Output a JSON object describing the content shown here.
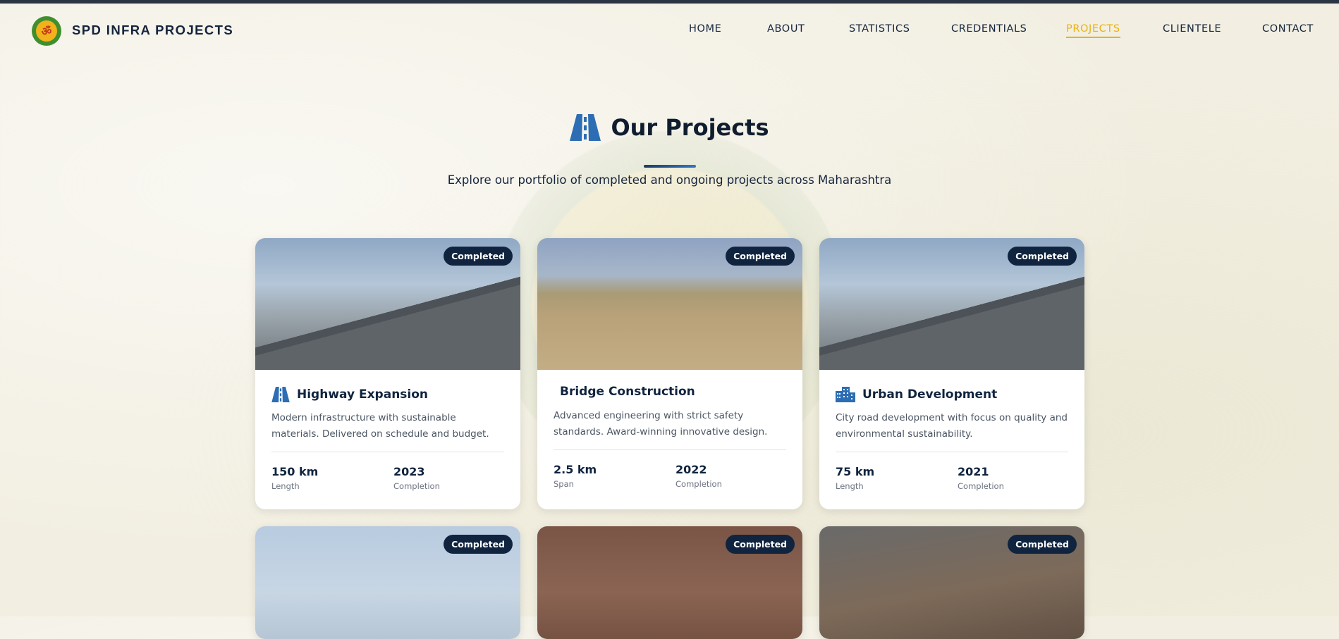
{
  "brand": {
    "name": "SPD INFRA PROJECTS",
    "logo_icon": "company-logo"
  },
  "nav": {
    "items": [
      {
        "label": "HOME"
      },
      {
        "label": "ABOUT"
      },
      {
        "label": "STATISTICS"
      },
      {
        "label": "CREDENTIALS"
      },
      {
        "label": "PROJECTS",
        "active": true
      },
      {
        "label": "CLIENTELE"
      },
      {
        "label": "CONTACT"
      }
    ]
  },
  "hero": {
    "icon": "road-icon",
    "title": "Our Projects",
    "subtitle": "Explore our portfolio of completed and ongoing projects across Maharashtra"
  },
  "projects": [
    {
      "badge": "Completed",
      "icon": "road-icon",
      "title": "Highway Expansion",
      "desc": "Modern infrastructure with sustainable materials. Delivered on schedule and budget.",
      "stat1_value": "150 km",
      "stat1_label": "Length",
      "stat2_value": "2023",
      "stat2_label": "Completion"
    },
    {
      "badge": "Completed",
      "icon": "",
      "title": "Bridge Construction",
      "desc": "Advanced engineering with strict safety standards. Award-winning innovative design.",
      "stat1_value": "2.5 km",
      "stat1_label": "Span",
      "stat2_value": "2022",
      "stat2_label": "Completion"
    },
    {
      "badge": "Completed",
      "icon": "city-icon",
      "title": "Urban Development",
      "desc": "City road development with focus on quality and environmental sustainability.",
      "stat1_value": "75 km",
      "stat1_label": "Length",
      "stat2_value": "2021",
      "stat2_label": "Completion"
    },
    {
      "badge": "Completed"
    },
    {
      "badge": "Completed"
    },
    {
      "badge": "Completed"
    }
  ],
  "colors": {
    "accent": "#eab214",
    "navy": "#10243f",
    "blue": "#2f77c4"
  }
}
